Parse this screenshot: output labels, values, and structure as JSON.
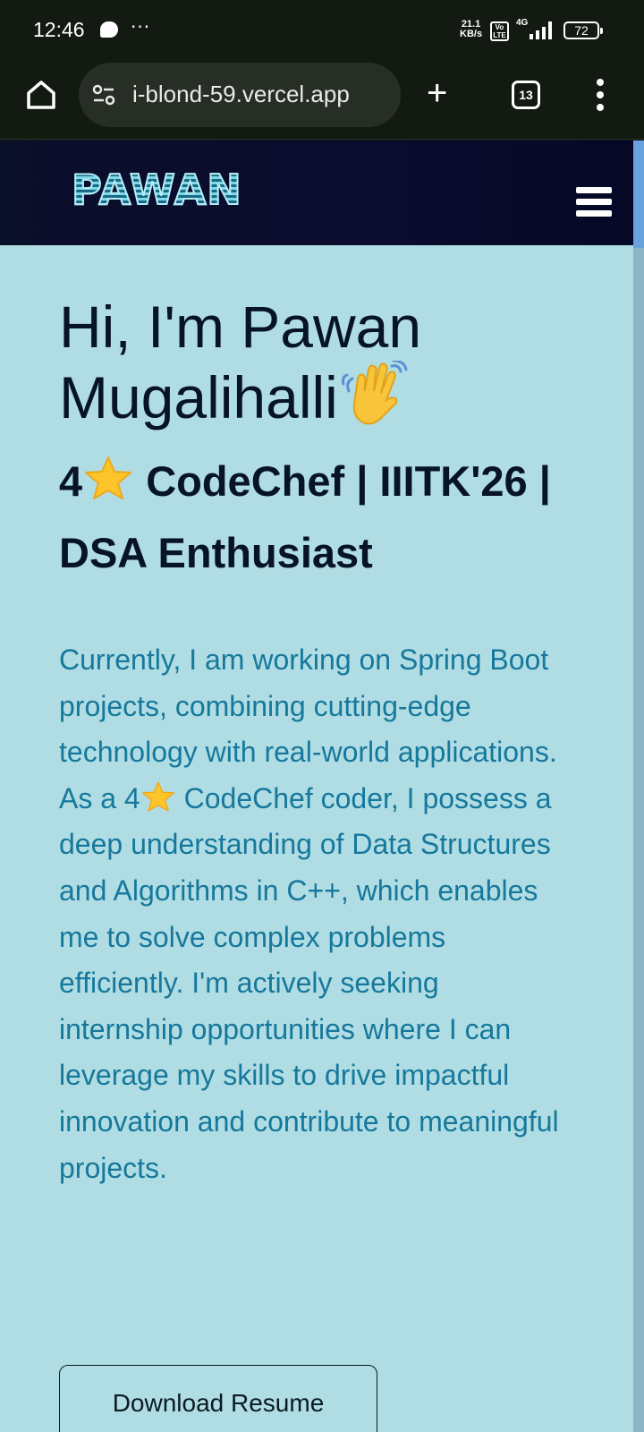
{
  "status_bar": {
    "time": "12:46",
    "dots": "···",
    "speed_value": "21.1",
    "speed_unit": "KB/s",
    "volte": "Vo LTE",
    "network": "4G",
    "battery": "72"
  },
  "browser": {
    "url": "i-blond-59.vercel.app",
    "tab_count": "13"
  },
  "site": {
    "logo": "PAWAN",
    "hero": {
      "title_line1": "Hi, I'm Pawan",
      "title_line2": "Mugalihalli",
      "subtitle_pre": "4",
      "subtitle_post": " CodeChef | IIITK'26 | DSA Enthusiast",
      "body_pre": "Currently, I am working on Spring Boot projects, combining cutting-edge technology with real-world applications. As a 4",
      "body_post": " CodeChef coder, I possess a deep understanding of Data Structures and Algorithms in C++, which enables me to solve complex problems efficiently. I'm actively seeking internship opportunities where I can leverage my skills to drive impactful innovation and contribute to meaningful projects."
    },
    "download_button": "Download Resume"
  },
  "icons": {
    "home": "home-icon",
    "site_info": "tune-icon",
    "new_tab": "plus-icon",
    "tabs": "tabs-icon",
    "menu": "more-vert-icon",
    "hamburger": "hamburger-icon",
    "wave": "waving-hand-icon",
    "star": "star-icon"
  },
  "colors": {
    "browser_bg": "#131a12",
    "site_bg": "#b0dde3",
    "nav_bg": "#0a0b2e",
    "heading": "#071428",
    "body_text": "#16789c"
  }
}
